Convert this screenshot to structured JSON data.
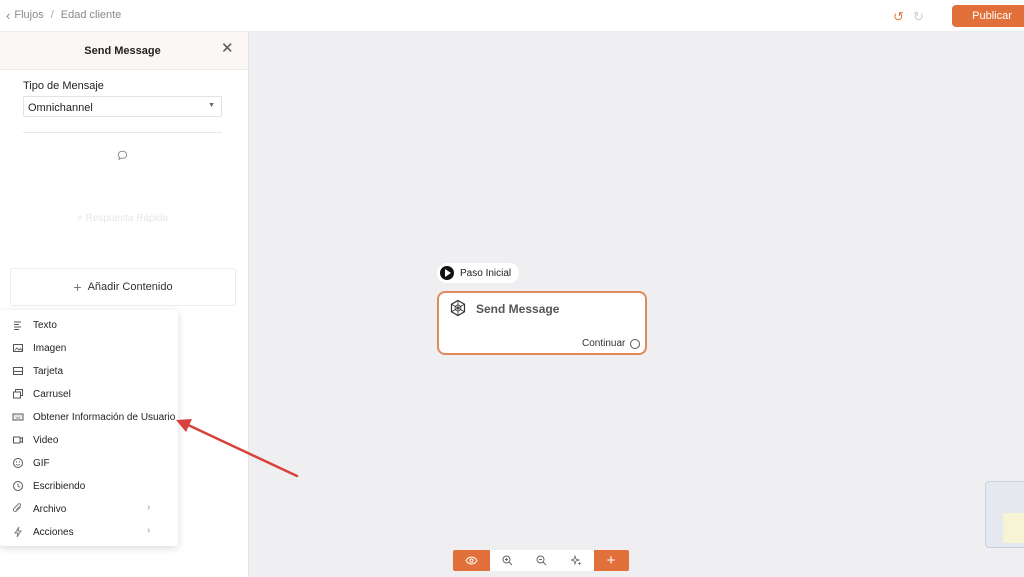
{
  "topbar": {
    "breadcrumb": [
      "Flujos",
      "Edad cliente"
    ],
    "publish_label": "Publicar"
  },
  "panel": {
    "title": "Send Message",
    "tipo_label": "Tipo de Mensaje",
    "tipo_value": "Omnichannel",
    "ghost_text": "+ Respuesta Rápida",
    "add_content_label": "Añadir Contenido"
  },
  "menu": {
    "items": [
      {
        "label": "Texto",
        "icon": "text-lines-icon"
      },
      {
        "label": "Imagen",
        "icon": "image-icon"
      },
      {
        "label": "Tarjeta",
        "icon": "card-icon"
      },
      {
        "label": "Carrusel",
        "icon": "carousel-icon"
      },
      {
        "label": "Obtener Información de Usuario",
        "icon": "keyboard-icon"
      },
      {
        "label": "Video",
        "icon": "video-icon"
      },
      {
        "label": "GIF",
        "icon": "gif-icon"
      },
      {
        "label": "Escribiendo",
        "icon": "clock-icon"
      },
      {
        "label": "Archivo",
        "icon": "paperclip-icon",
        "submenu": true
      },
      {
        "label": "Acciones",
        "icon": "lightning-icon",
        "submenu": true
      }
    ]
  },
  "canvas": {
    "start_label": "Paso Inicial",
    "node_title": "Send Message",
    "node_output": "Continuar"
  },
  "colors": {
    "accent": "#e2703a",
    "node_border": "#e08a5c",
    "canvas_bg": "#efeff1",
    "arrow": "#d9413c"
  }
}
